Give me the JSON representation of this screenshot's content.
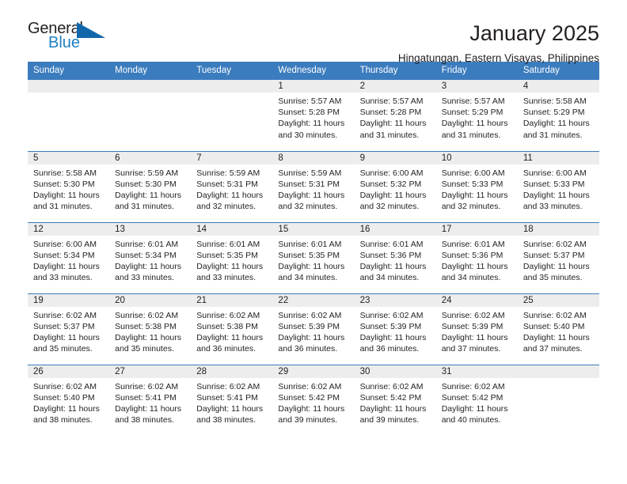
{
  "brand": {
    "name_part1": "General",
    "name_part2": "Blue",
    "triangle_icon": "triangle-icon",
    "colors": {
      "dark": "#231f20",
      "blue": "#1f7fc4",
      "triangle": "#1267ab"
    }
  },
  "header": {
    "title": "January 2025",
    "subtitle": "Hingatungan, Eastern Visayas, Philippines"
  },
  "calendar": {
    "header_bg": "#3b7cbe",
    "daynum_bg": "#ededed",
    "weekday_headers": [
      "Sunday",
      "Monday",
      "Tuesday",
      "Wednesday",
      "Thursday",
      "Friday",
      "Saturday"
    ],
    "weeks": [
      [
        {
          "day": "",
          "sunrise": "",
          "sunset": "",
          "daylight_line1": "",
          "daylight_line2": ""
        },
        {
          "day": "",
          "sunrise": "",
          "sunset": "",
          "daylight_line1": "",
          "daylight_line2": ""
        },
        {
          "day": "",
          "sunrise": "",
          "sunset": "",
          "daylight_line1": "",
          "daylight_line2": ""
        },
        {
          "day": "1",
          "sunrise": "Sunrise: 5:57 AM",
          "sunset": "Sunset: 5:28 PM",
          "daylight_line1": "Daylight: 11 hours",
          "daylight_line2": "and 30 minutes."
        },
        {
          "day": "2",
          "sunrise": "Sunrise: 5:57 AM",
          "sunset": "Sunset: 5:28 PM",
          "daylight_line1": "Daylight: 11 hours",
          "daylight_line2": "and 31 minutes."
        },
        {
          "day": "3",
          "sunrise": "Sunrise: 5:57 AM",
          "sunset": "Sunset: 5:29 PM",
          "daylight_line1": "Daylight: 11 hours",
          "daylight_line2": "and 31 minutes."
        },
        {
          "day": "4",
          "sunrise": "Sunrise: 5:58 AM",
          "sunset": "Sunset: 5:29 PM",
          "daylight_line1": "Daylight: 11 hours",
          "daylight_line2": "and 31 minutes."
        }
      ],
      [
        {
          "day": "5",
          "sunrise": "Sunrise: 5:58 AM",
          "sunset": "Sunset: 5:30 PM",
          "daylight_line1": "Daylight: 11 hours",
          "daylight_line2": "and 31 minutes."
        },
        {
          "day": "6",
          "sunrise": "Sunrise: 5:59 AM",
          "sunset": "Sunset: 5:30 PM",
          "daylight_line1": "Daylight: 11 hours",
          "daylight_line2": "and 31 minutes."
        },
        {
          "day": "7",
          "sunrise": "Sunrise: 5:59 AM",
          "sunset": "Sunset: 5:31 PM",
          "daylight_line1": "Daylight: 11 hours",
          "daylight_line2": "and 32 minutes."
        },
        {
          "day": "8",
          "sunrise": "Sunrise: 5:59 AM",
          "sunset": "Sunset: 5:31 PM",
          "daylight_line1": "Daylight: 11 hours",
          "daylight_line2": "and 32 minutes."
        },
        {
          "day": "9",
          "sunrise": "Sunrise: 6:00 AM",
          "sunset": "Sunset: 5:32 PM",
          "daylight_line1": "Daylight: 11 hours",
          "daylight_line2": "and 32 minutes."
        },
        {
          "day": "10",
          "sunrise": "Sunrise: 6:00 AM",
          "sunset": "Sunset: 5:33 PM",
          "daylight_line1": "Daylight: 11 hours",
          "daylight_line2": "and 32 minutes."
        },
        {
          "day": "11",
          "sunrise": "Sunrise: 6:00 AM",
          "sunset": "Sunset: 5:33 PM",
          "daylight_line1": "Daylight: 11 hours",
          "daylight_line2": "and 33 minutes."
        }
      ],
      [
        {
          "day": "12",
          "sunrise": "Sunrise: 6:00 AM",
          "sunset": "Sunset: 5:34 PM",
          "daylight_line1": "Daylight: 11 hours",
          "daylight_line2": "and 33 minutes."
        },
        {
          "day": "13",
          "sunrise": "Sunrise: 6:01 AM",
          "sunset": "Sunset: 5:34 PM",
          "daylight_line1": "Daylight: 11 hours",
          "daylight_line2": "and 33 minutes."
        },
        {
          "day": "14",
          "sunrise": "Sunrise: 6:01 AM",
          "sunset": "Sunset: 5:35 PM",
          "daylight_line1": "Daylight: 11 hours",
          "daylight_line2": "and 33 minutes."
        },
        {
          "day": "15",
          "sunrise": "Sunrise: 6:01 AM",
          "sunset": "Sunset: 5:35 PM",
          "daylight_line1": "Daylight: 11 hours",
          "daylight_line2": "and 34 minutes."
        },
        {
          "day": "16",
          "sunrise": "Sunrise: 6:01 AM",
          "sunset": "Sunset: 5:36 PM",
          "daylight_line1": "Daylight: 11 hours",
          "daylight_line2": "and 34 minutes."
        },
        {
          "day": "17",
          "sunrise": "Sunrise: 6:01 AM",
          "sunset": "Sunset: 5:36 PM",
          "daylight_line1": "Daylight: 11 hours",
          "daylight_line2": "and 34 minutes."
        },
        {
          "day": "18",
          "sunrise": "Sunrise: 6:02 AM",
          "sunset": "Sunset: 5:37 PM",
          "daylight_line1": "Daylight: 11 hours",
          "daylight_line2": "and 35 minutes."
        }
      ],
      [
        {
          "day": "19",
          "sunrise": "Sunrise: 6:02 AM",
          "sunset": "Sunset: 5:37 PM",
          "daylight_line1": "Daylight: 11 hours",
          "daylight_line2": "and 35 minutes."
        },
        {
          "day": "20",
          "sunrise": "Sunrise: 6:02 AM",
          "sunset": "Sunset: 5:38 PM",
          "daylight_line1": "Daylight: 11 hours",
          "daylight_line2": "and 35 minutes."
        },
        {
          "day": "21",
          "sunrise": "Sunrise: 6:02 AM",
          "sunset": "Sunset: 5:38 PM",
          "daylight_line1": "Daylight: 11 hours",
          "daylight_line2": "and 36 minutes."
        },
        {
          "day": "22",
          "sunrise": "Sunrise: 6:02 AM",
          "sunset": "Sunset: 5:39 PM",
          "daylight_line1": "Daylight: 11 hours",
          "daylight_line2": "and 36 minutes."
        },
        {
          "day": "23",
          "sunrise": "Sunrise: 6:02 AM",
          "sunset": "Sunset: 5:39 PM",
          "daylight_line1": "Daylight: 11 hours",
          "daylight_line2": "and 36 minutes."
        },
        {
          "day": "24",
          "sunrise": "Sunrise: 6:02 AM",
          "sunset": "Sunset: 5:39 PM",
          "daylight_line1": "Daylight: 11 hours",
          "daylight_line2": "and 37 minutes."
        },
        {
          "day": "25",
          "sunrise": "Sunrise: 6:02 AM",
          "sunset": "Sunset: 5:40 PM",
          "daylight_line1": "Daylight: 11 hours",
          "daylight_line2": "and 37 minutes."
        }
      ],
      [
        {
          "day": "26",
          "sunrise": "Sunrise: 6:02 AM",
          "sunset": "Sunset: 5:40 PM",
          "daylight_line1": "Daylight: 11 hours",
          "daylight_line2": "and 38 minutes."
        },
        {
          "day": "27",
          "sunrise": "Sunrise: 6:02 AM",
          "sunset": "Sunset: 5:41 PM",
          "daylight_line1": "Daylight: 11 hours",
          "daylight_line2": "and 38 minutes."
        },
        {
          "day": "28",
          "sunrise": "Sunrise: 6:02 AM",
          "sunset": "Sunset: 5:41 PM",
          "daylight_line1": "Daylight: 11 hours",
          "daylight_line2": "and 38 minutes."
        },
        {
          "day": "29",
          "sunrise": "Sunrise: 6:02 AM",
          "sunset": "Sunset: 5:42 PM",
          "daylight_line1": "Daylight: 11 hours",
          "daylight_line2": "and 39 minutes."
        },
        {
          "day": "30",
          "sunrise": "Sunrise: 6:02 AM",
          "sunset": "Sunset: 5:42 PM",
          "daylight_line1": "Daylight: 11 hours",
          "daylight_line2": "and 39 minutes."
        },
        {
          "day": "31",
          "sunrise": "Sunrise: 6:02 AM",
          "sunset": "Sunset: 5:42 PM",
          "daylight_line1": "Daylight: 11 hours",
          "daylight_line2": "and 40 minutes."
        },
        {
          "day": "",
          "sunrise": "",
          "sunset": "",
          "daylight_line1": "",
          "daylight_line2": ""
        }
      ]
    ]
  }
}
